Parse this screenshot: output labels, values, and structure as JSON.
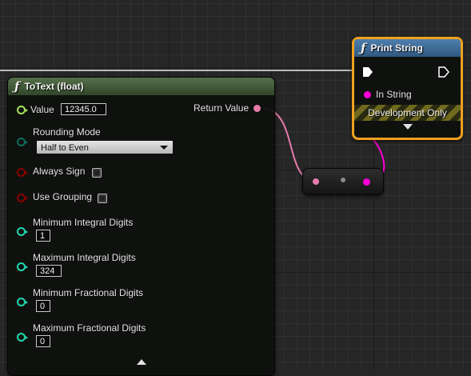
{
  "totext_node": {
    "title": "ToText (float)",
    "pins": {
      "value_label": "Value",
      "value": "12345.0",
      "return_label": "Return Value",
      "rounding_label": "Rounding Mode",
      "rounding_value": "Half to Even",
      "always_sign_label": "Always Sign",
      "use_grouping_label": "Use Grouping",
      "min_integral_label": "Minimum Integral Digits",
      "min_integral_value": "1",
      "max_integral_label": "Maximum Integral Digits",
      "max_integral_value": "324",
      "min_fractional_label": "Minimum Fractional Digits",
      "min_fractional_value": "0",
      "max_fractional_label": "Maximum Fractional Digits",
      "max_fractional_value": "0"
    },
    "always_sign_checked": false,
    "use_grouping_checked": false
  },
  "print_node": {
    "title": "Print String",
    "in_string_label": "In String",
    "dev_only_label": "Development Only"
  },
  "colors": {
    "totext_header": "#3f5a33",
    "print_header": "#3e6a93",
    "selection_outline": "#f0a01e",
    "float_pin": "#a6e35a",
    "enum_pin": "#0b6f5c",
    "bool_pin": "#8a0000",
    "int_pin": "#1fd8b0",
    "text_pin": "#e87bac",
    "string_pin": "#ff00d4"
  }
}
